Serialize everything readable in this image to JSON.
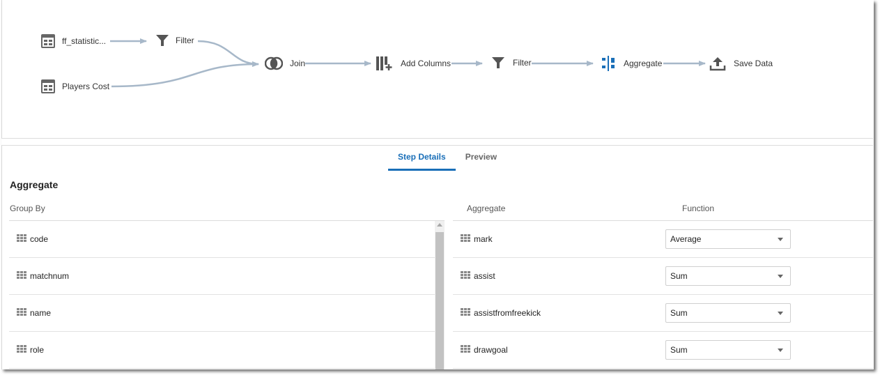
{
  "flow": {
    "nodes": [
      {
        "id": "src1",
        "label": "ff_statistic...",
        "icon": "table-icon"
      },
      {
        "id": "filter1",
        "label": "Filter",
        "icon": "filter-icon"
      },
      {
        "id": "src2",
        "label": "Players Cost",
        "icon": "table-icon"
      },
      {
        "id": "join",
        "label": "Join",
        "icon": "join-icon"
      },
      {
        "id": "addcols",
        "label": "Add Columns",
        "icon": "add-columns-icon"
      },
      {
        "id": "filter2",
        "label": "Filter",
        "icon": "filter-icon"
      },
      {
        "id": "aggregate",
        "label": "Aggregate",
        "icon": "aggregate-icon"
      },
      {
        "id": "save",
        "label": "Save Data",
        "icon": "upload-icon"
      }
    ],
    "colors": {
      "connector": "#a7b8c9",
      "icon": "#555555",
      "accent": "#1a6fb8"
    }
  },
  "tabs": {
    "step_details": "Step Details",
    "preview": "Preview"
  },
  "step": {
    "title": "Aggregate",
    "group_by_header": "Group By",
    "aggregate_header": "Aggregate",
    "function_header": "Function",
    "group_by": [
      "code",
      "matchnum",
      "name",
      "role"
    ],
    "aggregates": [
      {
        "column": "mark",
        "function": "Average"
      },
      {
        "column": "assist",
        "function": "Sum"
      },
      {
        "column": "assistfromfreekick",
        "function": "Sum"
      },
      {
        "column": "drawgoal",
        "function": "Sum"
      }
    ]
  }
}
